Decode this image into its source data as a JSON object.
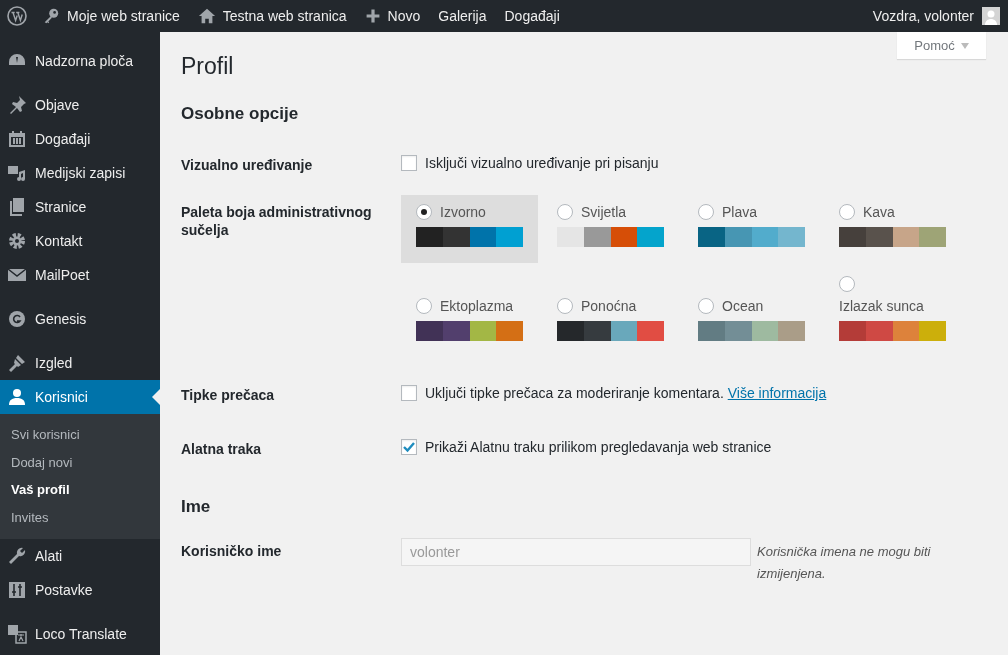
{
  "admin_bar": {
    "items": [
      {
        "label": "Moje web stranice"
      },
      {
        "label": "Testna web stranica"
      },
      {
        "label": "Novo"
      },
      {
        "label": "Galerija"
      },
      {
        "label": "Događaji"
      }
    ],
    "account": "Vozdra, volonter"
  },
  "sidebar": {
    "groups": [
      {
        "items": [
          {
            "label": "Nadzorna ploča",
            "selected": false
          }
        ]
      },
      {
        "items": [
          {
            "label": "Objave",
            "selected": false
          },
          {
            "label": "Događaji",
            "selected": false
          },
          {
            "label": "Medijski zapisi",
            "selected": false
          },
          {
            "label": "Stranice",
            "selected": false
          },
          {
            "label": "Kontakt",
            "selected": false
          },
          {
            "label": "MailPoet",
            "selected": false
          }
        ]
      },
      {
        "items": [
          {
            "label": "Genesis",
            "selected": false
          }
        ]
      },
      {
        "items": [
          {
            "label": "Izgled",
            "selected": false
          },
          {
            "label": "Korisnici",
            "selected": true,
            "children": [
              {
                "label": "Svi korisnici",
                "selected": false
              },
              {
                "label": "Dodaj novi",
                "selected": false
              },
              {
                "label": "Vaš profil",
                "selected": true
              },
              {
                "label": "Invites",
                "selected": false
              }
            ]
          },
          {
            "label": "Alati",
            "selected": false
          },
          {
            "label": "Postavke",
            "selected": false
          }
        ]
      },
      {
        "items": [
          {
            "label": "Loco Translate",
            "selected": false
          }
        ]
      }
    ]
  },
  "help_button": "Pomoć",
  "title": "Profil",
  "sections": [
    {
      "heading": "Osobne opcije",
      "rows": [
        {
          "kind": "checkbox",
          "label": "Vizualno uređivanje",
          "text": "Isključi vizualno uređivanje pri pisanju",
          "checked": false
        },
        {
          "kind": "palette",
          "label": "Paleta boja administrativnog sučelja",
          "schemes": [
            {
              "name": "Izvorno",
              "selected": true,
              "swatches": [
                {
                  "color": "#222222"
                },
                {
                  "color": "#333333"
                },
                {
                  "color": "#0073aa"
                },
                {
                  "color": "#00a0d2"
                }
              ]
            },
            {
              "name": "Svijetla",
              "selected": false,
              "swatches": [
                {
                  "color": "#e5e5e5"
                },
                {
                  "color": "#999999"
                },
                {
                  "color": "#d64e07"
                },
                {
                  "color": "#04a4cc"
                }
              ]
            },
            {
              "name": "Plava",
              "selected": false,
              "swatches": [
                {
                  "color": "#096484"
                },
                {
                  "color": "#4796b3"
                },
                {
                  "color": "#52accc"
                },
                {
                  "color": "#74b6ce"
                }
              ]
            },
            {
              "name": "Kava",
              "selected": false,
              "swatches": [
                {
                  "color": "#46403c"
                },
                {
                  "color": "#59524c"
                },
                {
                  "color": "#c7a589"
                },
                {
                  "color": "#9ea476"
                }
              ]
            },
            {
              "name": "Ektoplazma",
              "selected": false,
              "swatches": [
                {
                  "color": "#413256"
                },
                {
                  "color": "#523f6d"
                },
                {
                  "color": "#a3b745"
                },
                {
                  "color": "#d46f15"
                }
              ]
            },
            {
              "name": "Ponoćna",
              "selected": false,
              "swatches": [
                {
                  "color": "#25282b"
                },
                {
                  "color": "#363b3f"
                },
                {
                  "color": "#69a8bb"
                },
                {
                  "color": "#e14d43"
                }
              ]
            },
            {
              "name": "Ocean",
              "selected": false,
              "swatches": [
                {
                  "color": "#627c83"
                },
                {
                  "color": "#738e96"
                },
                {
                  "color": "#9ebaa0"
                },
                {
                  "color": "#aa9d88"
                }
              ]
            },
            {
              "name": "Izlazak sunca",
              "selected": false,
              "swatches": [
                {
                  "color": "#b43c38"
                },
                {
                  "color": "#cf4944"
                },
                {
                  "color": "#dd823b"
                },
                {
                  "color": "#ccaf0b"
                }
              ]
            }
          ]
        },
        {
          "kind": "checkbox",
          "label": "Tipke prečaca",
          "text": "Uključi tipke prečaca za moderiranje komentara.",
          "link": "Više informacija",
          "checked": false
        },
        {
          "kind": "checkbox",
          "label": "Alatna traka",
          "text": "Prikaži Alatnu traku prilikom pregledavanja web stranice",
          "checked": true
        }
      ]
    },
    {
      "heading": "Ime",
      "rows": [
        {
          "kind": "text",
          "label": "Korisničko ime",
          "value": "volonter",
          "disabled": true,
          "description": "Korisnička imena ne mogu biti izmijenjena."
        }
      ]
    }
  ]
}
